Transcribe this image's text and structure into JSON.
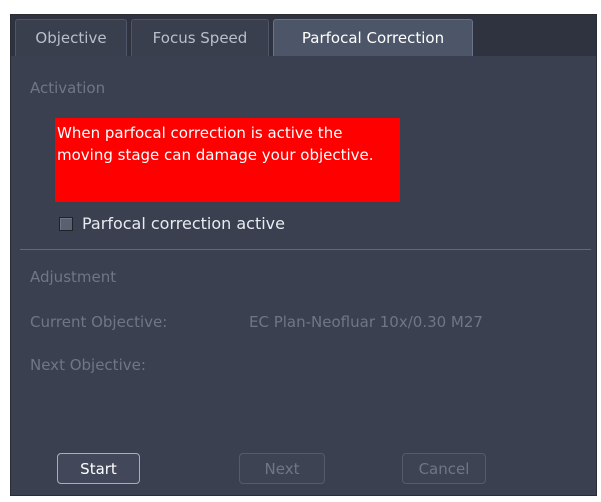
{
  "tabs": [
    {
      "label": "Objective"
    },
    {
      "label": "Focus Speed"
    },
    {
      "label": "Parfocal Correction"
    }
  ],
  "activation": {
    "heading": "Activation",
    "warning": "When parfocal correction is active the moving stage can damage your objective.",
    "checkbox_label": "Parfocal correction active",
    "checkbox_checked": false
  },
  "adjustment": {
    "heading": "Adjustment",
    "current_objective_label": "Current Objective:",
    "current_objective_value": "EC Plan-Neofluar 10x/0.30 M27",
    "next_objective_label": "Next Objective:",
    "next_objective_value": ""
  },
  "buttons": {
    "start": "Start",
    "next": "Next",
    "cancel": "Cancel"
  },
  "colors": {
    "panel_bg": "#3b4050",
    "warning_bg": "#fe0000",
    "active_tab_bg": "#4d5568"
  }
}
